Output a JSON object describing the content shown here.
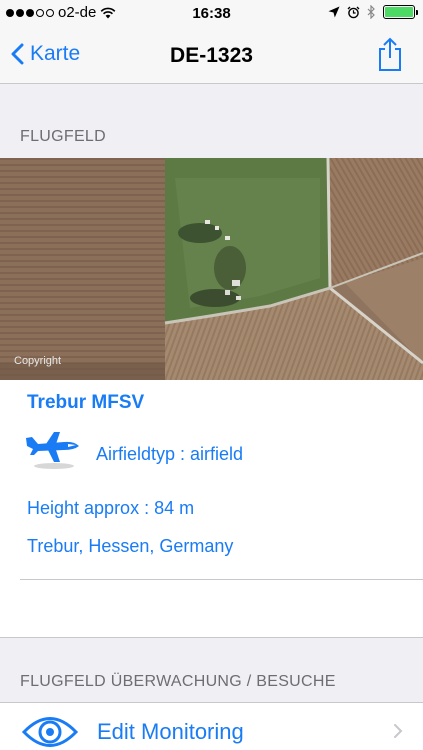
{
  "status_bar": {
    "carrier": "o2-de",
    "time": "16:38",
    "battery_level": 1.0,
    "battery_color": "#4cd964"
  },
  "nav": {
    "back_label": "Karte",
    "title": "DE-1323",
    "share_icon": "share-icon"
  },
  "sections": {
    "airfield_header": "FLUGFELD",
    "monitoring_header": "FLUGFELD ÜBERWACHUNG / BESUCHE"
  },
  "map": {
    "copyright": "Copyright"
  },
  "airfield": {
    "name": "Trebur MFSV",
    "type_text": "Airfieldtyp : airfield",
    "height_text": "Height approx : 84 m",
    "location_text": "Trebur, Hessen, Germany"
  },
  "monitoring": {
    "label": "Edit Monitoring"
  },
  "colors": {
    "accent": "#1a7cf5",
    "background": "#efeff4",
    "header_text": "#6d6d72"
  }
}
